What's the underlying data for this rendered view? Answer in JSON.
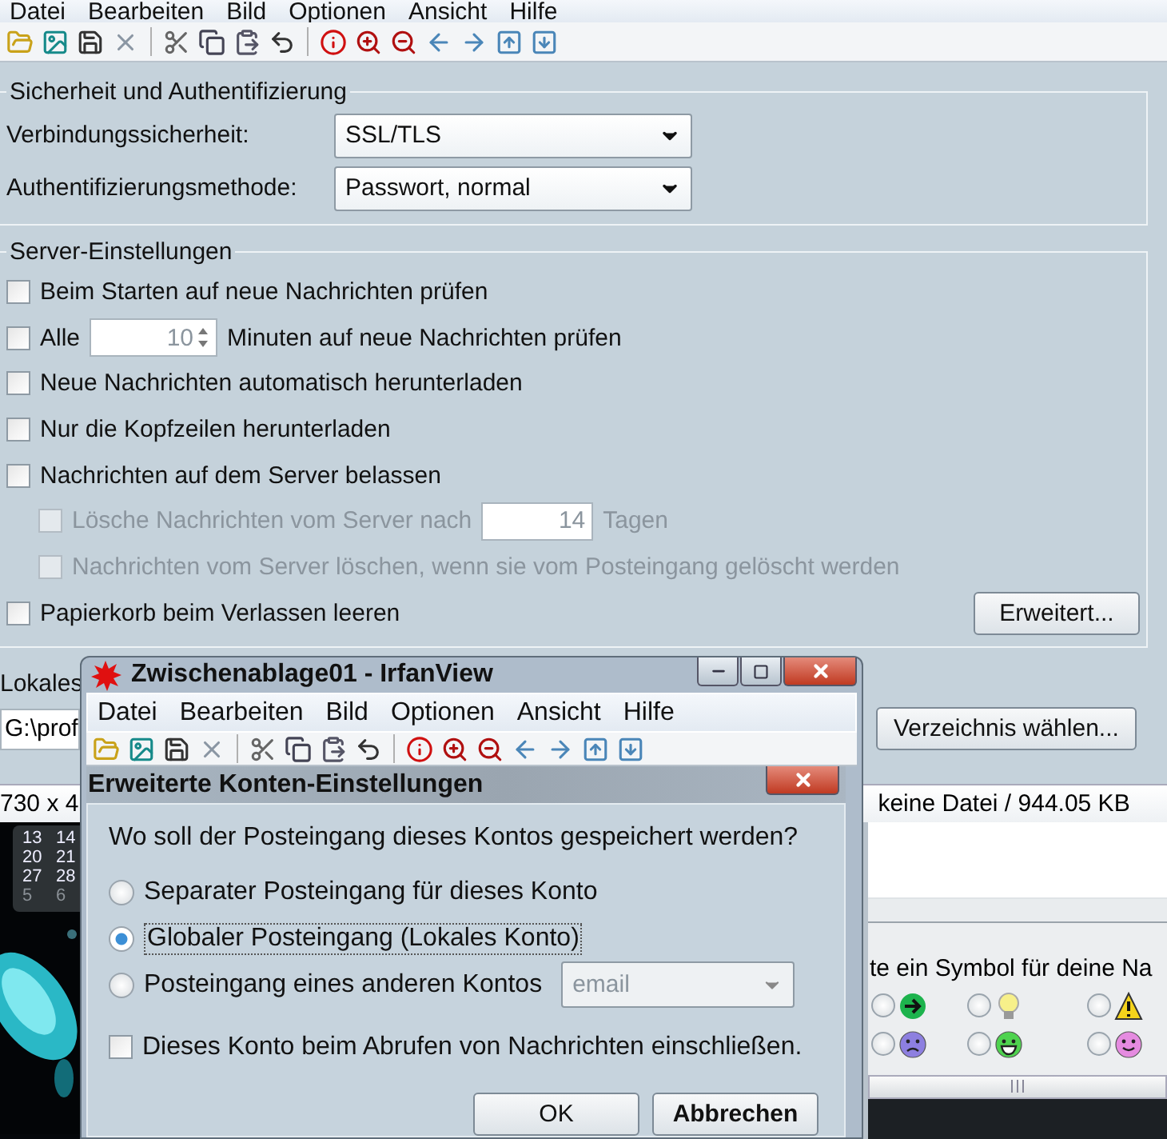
{
  "background_window": {
    "menu": [
      "Datei",
      "Bearbeiten",
      "Bild",
      "Optionen",
      "Ansicht",
      "Hilfe"
    ]
  },
  "security_group": {
    "title": "Sicherheit und Authentifizierung",
    "fields": [
      {
        "label": "Verbindungssicherheit:",
        "value": "SSL/TLS"
      },
      {
        "label": "Authentifizierungsmethode:",
        "value": "Passwort, normal"
      }
    ]
  },
  "server_group": {
    "title": "Server-Einstellungen",
    "options": [
      {
        "kind": "checkbox",
        "label": "Beim Starten auf neue Nachrichten prüfen",
        "checked": false
      },
      {
        "kind": "interval",
        "label": "Alle",
        "value": "10",
        "unit": "Minuten auf neue Nachrichten prüfen",
        "checked": false
      },
      {
        "kind": "checkbox",
        "label": "Neue Nachrichten automatisch herunterladen",
        "checked": false
      },
      {
        "kind": "checkbox",
        "label": "Nur die Kopfzeilen herunterladen",
        "checked": false
      },
      {
        "kind": "checkbox",
        "label": "Nachrichten auf dem Server belassen",
        "checked": false,
        "children": [
          {
            "kind": "interval",
            "label": "Lösche Nachrichten vom Server nach",
            "value": "14",
            "unit": "Tagen",
            "checked": false,
            "disabled": true
          },
          {
            "kind": "checkbox",
            "label": "Nachrichten vom Server löschen, wenn sie vom Posteingang gelöscht werden",
            "checked": false,
            "disabled": true
          }
        ]
      },
      {
        "kind": "checkbox",
        "label": "Papierkorb beim Verlassen leeren",
        "checked": false,
        "button": "Erweitert..."
      }
    ]
  },
  "local_folder": {
    "label": "Lokales",
    "path": "G:\\prof",
    "button": "Verzeichnis wählen..."
  },
  "status_bar": {
    "dimensions": "730 x 4",
    "file_info": "keine Datei / 944.05 KB"
  },
  "calendar": [
    {
      "days": [
        "13",
        "14"
      ],
      "dimmed": false
    },
    {
      "days": [
        "20",
        "21"
      ],
      "dimmed": false
    },
    {
      "days": [
        "27",
        "28"
      ],
      "dimmed": false
    },
    {
      "days": [
        "5",
        "6"
      ],
      "dimmed": true
    }
  ],
  "symbol_picker": {
    "prompt": "te ein Symbol für deine Na",
    "symbols": [
      {
        "kind": "arrow",
        "selected": false
      },
      {
        "kind": "bulb",
        "selected": false
      },
      {
        "kind": "warning",
        "selected": false
      },
      {
        "kind": "sad",
        "selected": false
      },
      {
        "kind": "grin",
        "selected": false
      },
      {
        "kind": "smile",
        "selected": false
      }
    ]
  },
  "irfanview": {
    "title": "Zwischenablage01 - IrfanView",
    "menu": [
      "Datei",
      "Bearbeiten",
      "Bild",
      "Optionen",
      "Ansicht",
      "Hilfe"
    ]
  },
  "dialog": {
    "title": "Erweiterte Konten-Einstellungen",
    "question": "Wo soll der Posteingang dieses Kontos gespeichert werden?",
    "inbox_options": [
      {
        "label": "Separater Posteingang für dieses Konto",
        "selected": false
      },
      {
        "label": "Globaler Posteingang (Lokales Konto)",
        "selected": true
      },
      {
        "label": "Posteingang eines anderen Kontos",
        "selected": false,
        "account": "email"
      }
    ],
    "include_check": {
      "label": "Dieses Konto beim Abrufen von Nachrichten einschließen.",
      "checked": false
    },
    "buttons": [
      "OK",
      "Abbrechen"
    ]
  }
}
